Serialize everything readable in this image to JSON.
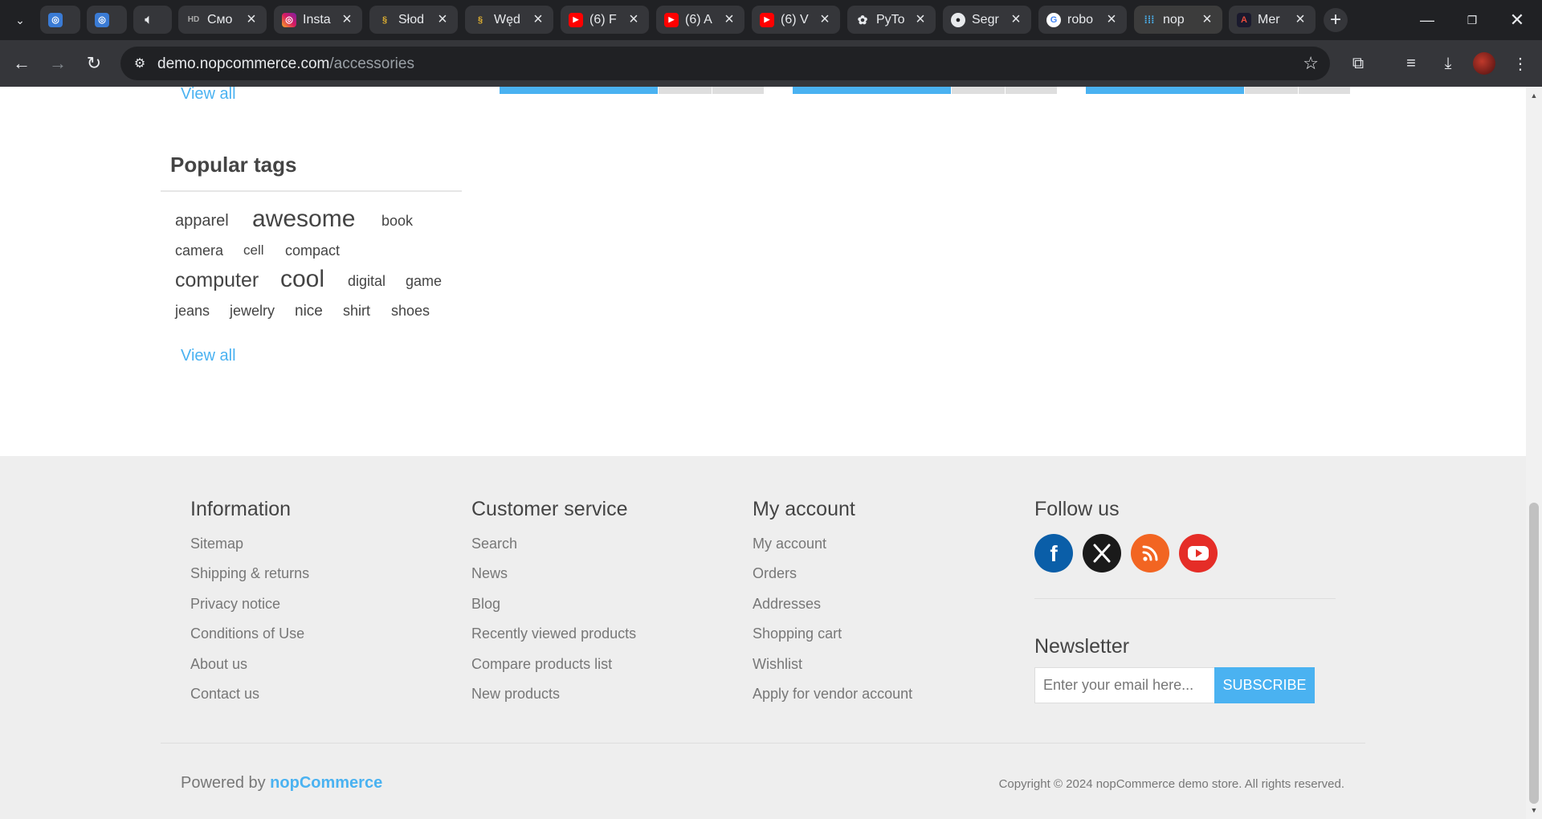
{
  "browser": {
    "tabs": [
      {
        "title": "",
        "icon": "copilot-icon"
      },
      {
        "title": "",
        "icon": "copilot-icon"
      },
      {
        "title": "",
        "icon": "speaker-icon"
      },
      {
        "title": "Смо",
        "icon": "hd-icon"
      },
      {
        "title": "Insta",
        "icon": "instagram-icon"
      },
      {
        "title": "Słod",
        "icon": "bee-icon"
      },
      {
        "title": "Węd",
        "icon": "bee-icon"
      },
      {
        "title": "(6) F",
        "icon": "youtube-icon"
      },
      {
        "title": "(6) A",
        "icon": "youtube-icon"
      },
      {
        "title": "(6) V",
        "icon": "youtube-icon"
      },
      {
        "title": "PyTo",
        "icon": "openai-icon"
      },
      {
        "title": "Segr",
        "icon": "github-icon"
      },
      {
        "title": "robo",
        "icon": "google-icon"
      },
      {
        "title": "nop",
        "icon": "nopcommerce-icon"
      },
      {
        "title": "Mer",
        "icon": "app-icon"
      }
    ],
    "url_host": "demo.nopcommerce.com",
    "url_path": "/accessories"
  },
  "sidebar": {
    "top_view_all": "View all",
    "popular_tags_title": "Popular tags",
    "tags": [
      {
        "label": "apparel",
        "size": 20
      },
      {
        "label": "awesome",
        "size": 30
      },
      {
        "label": "book",
        "size": 18
      },
      {
        "label": "camera",
        "size": 18
      },
      {
        "label": "cell",
        "size": 17
      },
      {
        "label": "compact",
        "size": 18
      },
      {
        "label": "computer",
        "size": 25
      },
      {
        "label": "cool",
        "size": 30
      },
      {
        "label": "digital",
        "size": 18
      },
      {
        "label": "game",
        "size": 18
      },
      {
        "label": "jeans",
        "size": 18
      },
      {
        "label": "jewelry",
        "size": 18
      },
      {
        "label": "nice",
        "size": 19
      },
      {
        "label": "shirt",
        "size": 18
      },
      {
        "label": "shoes",
        "size": 18
      }
    ],
    "view_all": "View all"
  },
  "footer": {
    "information": {
      "title": "Information",
      "links": [
        "Sitemap",
        "Shipping & returns",
        "Privacy notice",
        "Conditions of Use",
        "About us",
        "Contact us"
      ]
    },
    "customer_service": {
      "title": "Customer service",
      "links": [
        "Search",
        "News",
        "Blog",
        "Recently viewed products",
        "Compare products list",
        "New products"
      ]
    },
    "my_account": {
      "title": "My account",
      "links": [
        "My account",
        "Orders",
        "Addresses",
        "Shopping cart",
        "Wishlist",
        "Apply for vendor account"
      ]
    },
    "follow_us": {
      "title": "Follow us",
      "socials": [
        {
          "name": "facebook-icon",
          "color": "#0a5ea8"
        },
        {
          "name": "x-icon",
          "color": "#1a1a1a"
        },
        {
          "name": "rss-icon",
          "color": "#f26522"
        },
        {
          "name": "youtube-icon",
          "color": "#e52d27"
        }
      ]
    },
    "newsletter": {
      "title": "Newsletter",
      "placeholder": "Enter your email here...",
      "button": "SUBSCRIBE"
    },
    "powered_prefix": "Powered by ",
    "powered_brand": "nopCommerce",
    "copyright": "Copyright © 2024 nopCommerce demo store. All rights reserved."
  },
  "colors": {
    "accent": "#4ab2f1",
    "footer_bg": "#eeeeee",
    "text": "#444444",
    "muted": "#777777"
  }
}
